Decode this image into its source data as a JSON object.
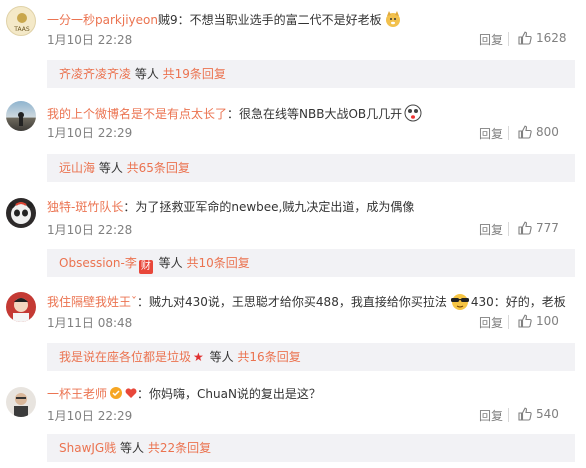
{
  "comments": [
    {
      "username": "一分一秒parkjiyeon",
      "text": "贼9：不想当职业选手的富二代不是好老板",
      "time": "1月10日 22:28",
      "reply_label": "回复",
      "likes": "1628",
      "replies": {
        "users": "齐凌齐凌齐凌",
        "others": " 等人 ",
        "count": "共19条回复"
      },
      "avatar_text": "TAAS"
    },
    {
      "username": "我的上个微博名是不是有点太长了",
      "text": "：很急在线等NBB大战OB几几开",
      "time": "1月10日 22:29",
      "reply_label": "回复",
      "likes": "800",
      "replies": {
        "users": "远山海",
        "others": " 等人 ",
        "count": "共65条回复"
      }
    },
    {
      "username": "独特-斑竹队长",
      "text": "：为了拯救亚军命的newbee,贼九决定出道，成为偶像",
      "time": "1月10日 22:28",
      "reply_label": "回复",
      "likes": "777",
      "replies": {
        "users": "Obsession-李",
        "badge": "财",
        "others": " 等人 ",
        "count": "共10条回复"
      }
    },
    {
      "username": "我住隔壁我姓王ˇ",
      "text": "：贼九对430说，王思聪才给你买488，我直接给你买拉法",
      "text2": "430：好的，老板",
      "time": "1月11日 08:48",
      "reply_label": "回复",
      "likes": "100",
      "replies": {
        "users": "我是说在座各位都是垃圾",
        "star": "★",
        "others": " 等人 ",
        "count": "共16条回复"
      }
    },
    {
      "username": "一杯王老师",
      "text": "：你妈嗨，ChuaN说的复出是这？",
      "time": "1月10日 22:29",
      "reply_label": "回复",
      "likes": "540",
      "replies": {
        "users": "ShawJG贱",
        "others": " 等人 ",
        "count": "共22条回复"
      }
    }
  ],
  "colors": {
    "username": "#eb7350",
    "meta": "#808080",
    "reply_bg": "#f2f2f5"
  }
}
